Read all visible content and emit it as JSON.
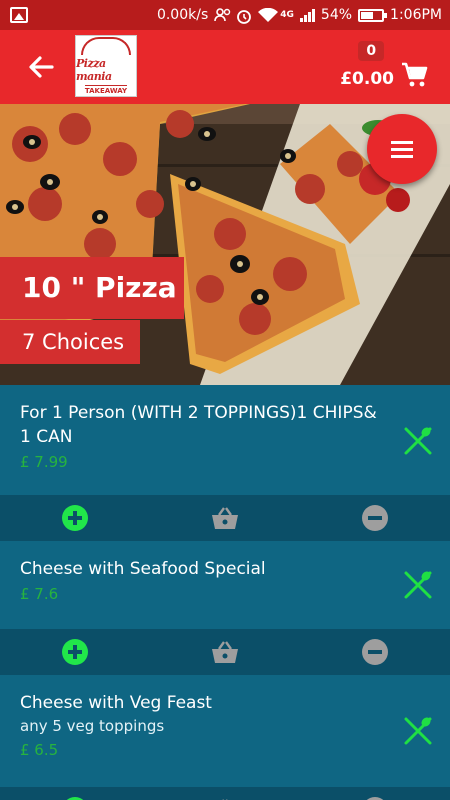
{
  "status_bar": {
    "speed": "0.00k/s",
    "network": "4G",
    "battery": "54%",
    "time": "1:06PM"
  },
  "app_bar": {
    "logo_text_top": "Pizza mania",
    "logo_text_bottom": "TAKEAWAY",
    "cart_count": "0",
    "cart_total": "£0.00"
  },
  "category": {
    "title": "10 \" Pizza",
    "choices": "7 Choices"
  },
  "items": [
    {
      "title": "For 1 Person (WITH 2 TOPPINGS)1 CHIPS& 1 CAN",
      "description": "",
      "price": "£ 7.99"
    },
    {
      "title": "Cheese with Seafood Special",
      "description": "",
      "price": "£ 7.6"
    },
    {
      "title": "Cheese with Veg Feast",
      "description": "any 5 veg toppings",
      "price": "£ 6.5"
    }
  ],
  "colors": {
    "primary_red": "#e8282b",
    "item_bg": "#0f6683",
    "action_bg": "#0b4f68",
    "price_green": "#27b33f",
    "add_green": "#21e64a"
  },
  "icons": [
    "back-arrow-icon",
    "cart-icon",
    "menu-icon",
    "fork-spoon-icon",
    "add-icon",
    "basket-icon",
    "remove-icon"
  ]
}
